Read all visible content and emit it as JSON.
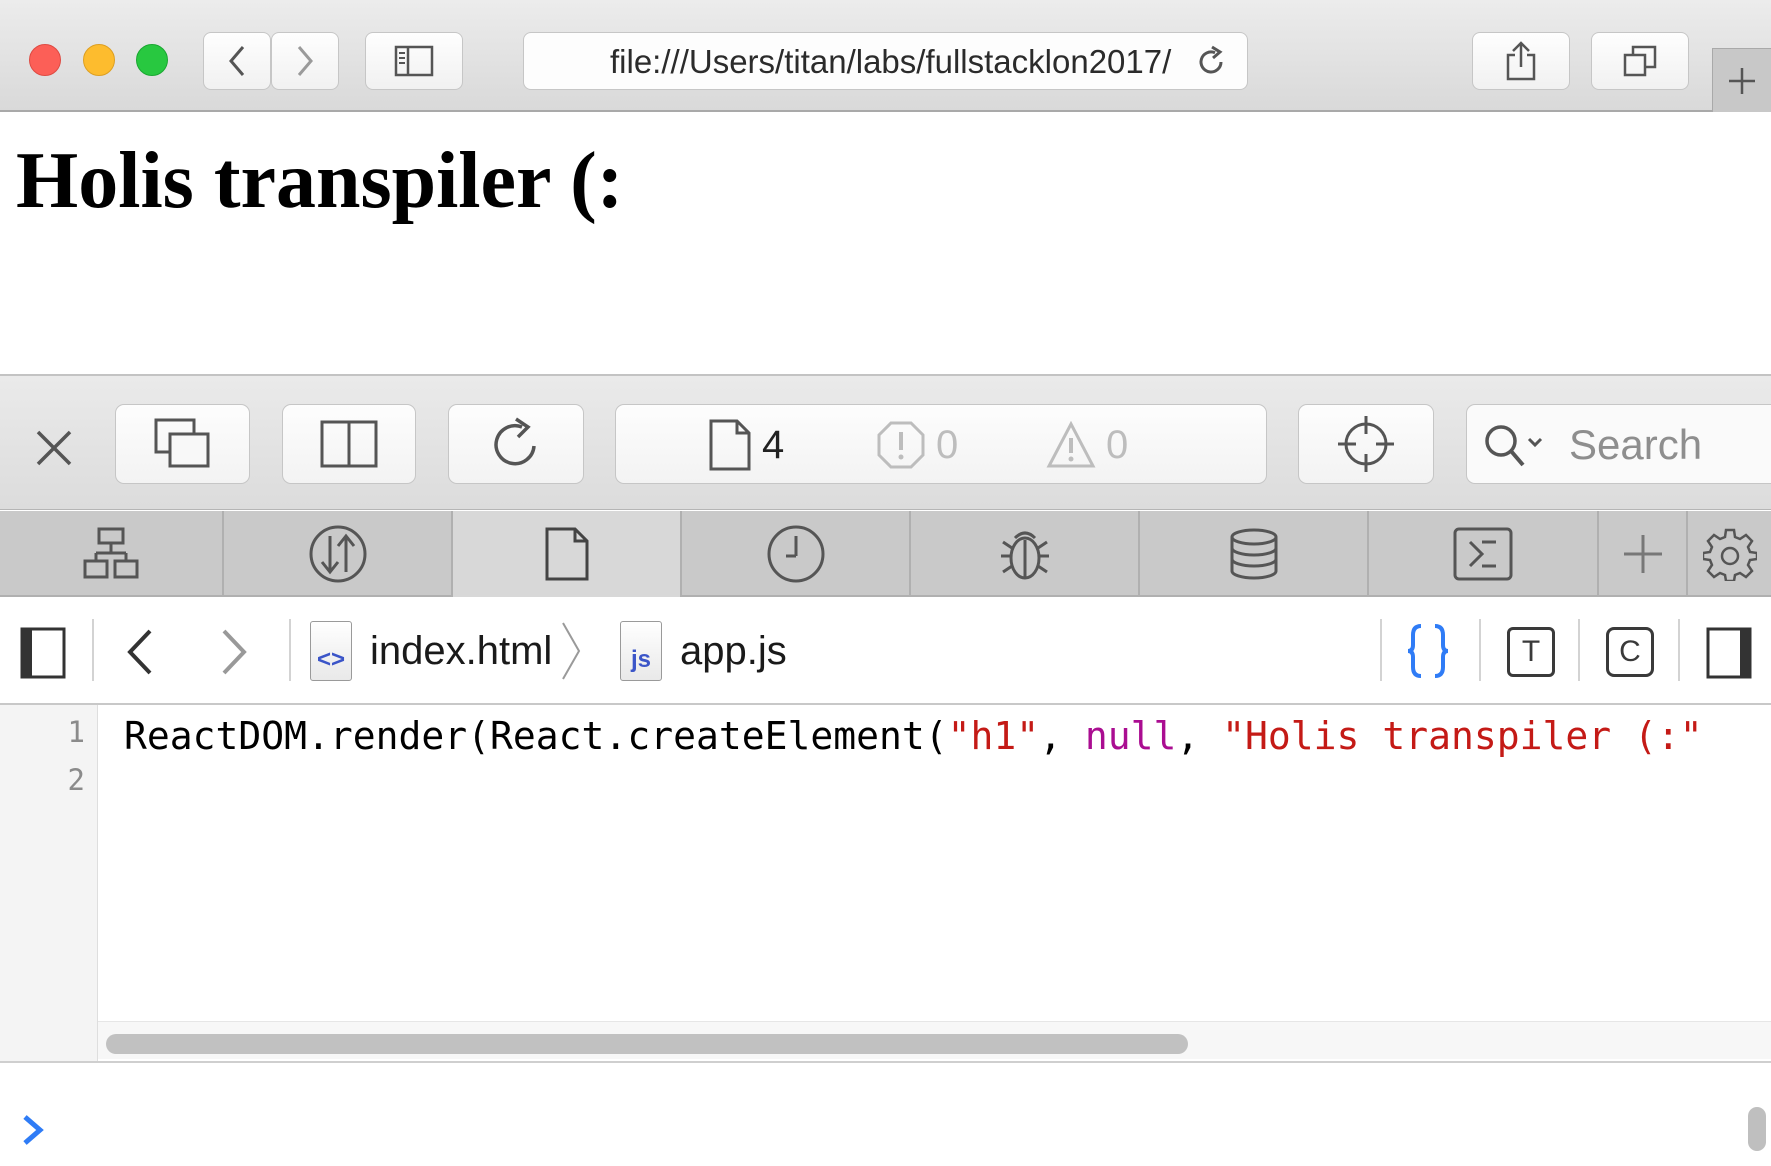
{
  "browser": {
    "url": "file:///Users/titan/labs/fullstacklon2017/",
    "icons": [
      "back-icon",
      "forward-icon",
      "sidebar-icon",
      "reload-icon",
      "share-icon",
      "tabs-icon",
      "plus-icon"
    ]
  },
  "page": {
    "heading": "Holis transpiler (:"
  },
  "inspector": {
    "counts": {
      "resources": "4",
      "errors": "0",
      "warnings": "0"
    },
    "search_placeholder": "Search",
    "tabs": [
      "elements",
      "network",
      "resources",
      "timelines",
      "debugger",
      "storage",
      "console",
      "new-tab",
      "settings"
    ],
    "active_tab": "resources",
    "breadcrumb": {
      "file1": "index.html",
      "file1_glyph": "<>",
      "file2": "app.js",
      "file2_glyph": "js"
    },
    "toggle_labels": {
      "type": "T",
      "code_coverage": "C"
    },
    "editor": {
      "line_numbers": [
        "1",
        "2"
      ],
      "code_tokens": [
        "ReactDOM.render(React.createElement(",
        "\"h1\"",
        ", ",
        "null",
        ", ",
        "\"Holis transpiler (:\""
      ]
    }
  },
  "colors": {
    "string": "#c41a16",
    "keyword": "#aa0d91",
    "accent": "#2f7cf6"
  }
}
